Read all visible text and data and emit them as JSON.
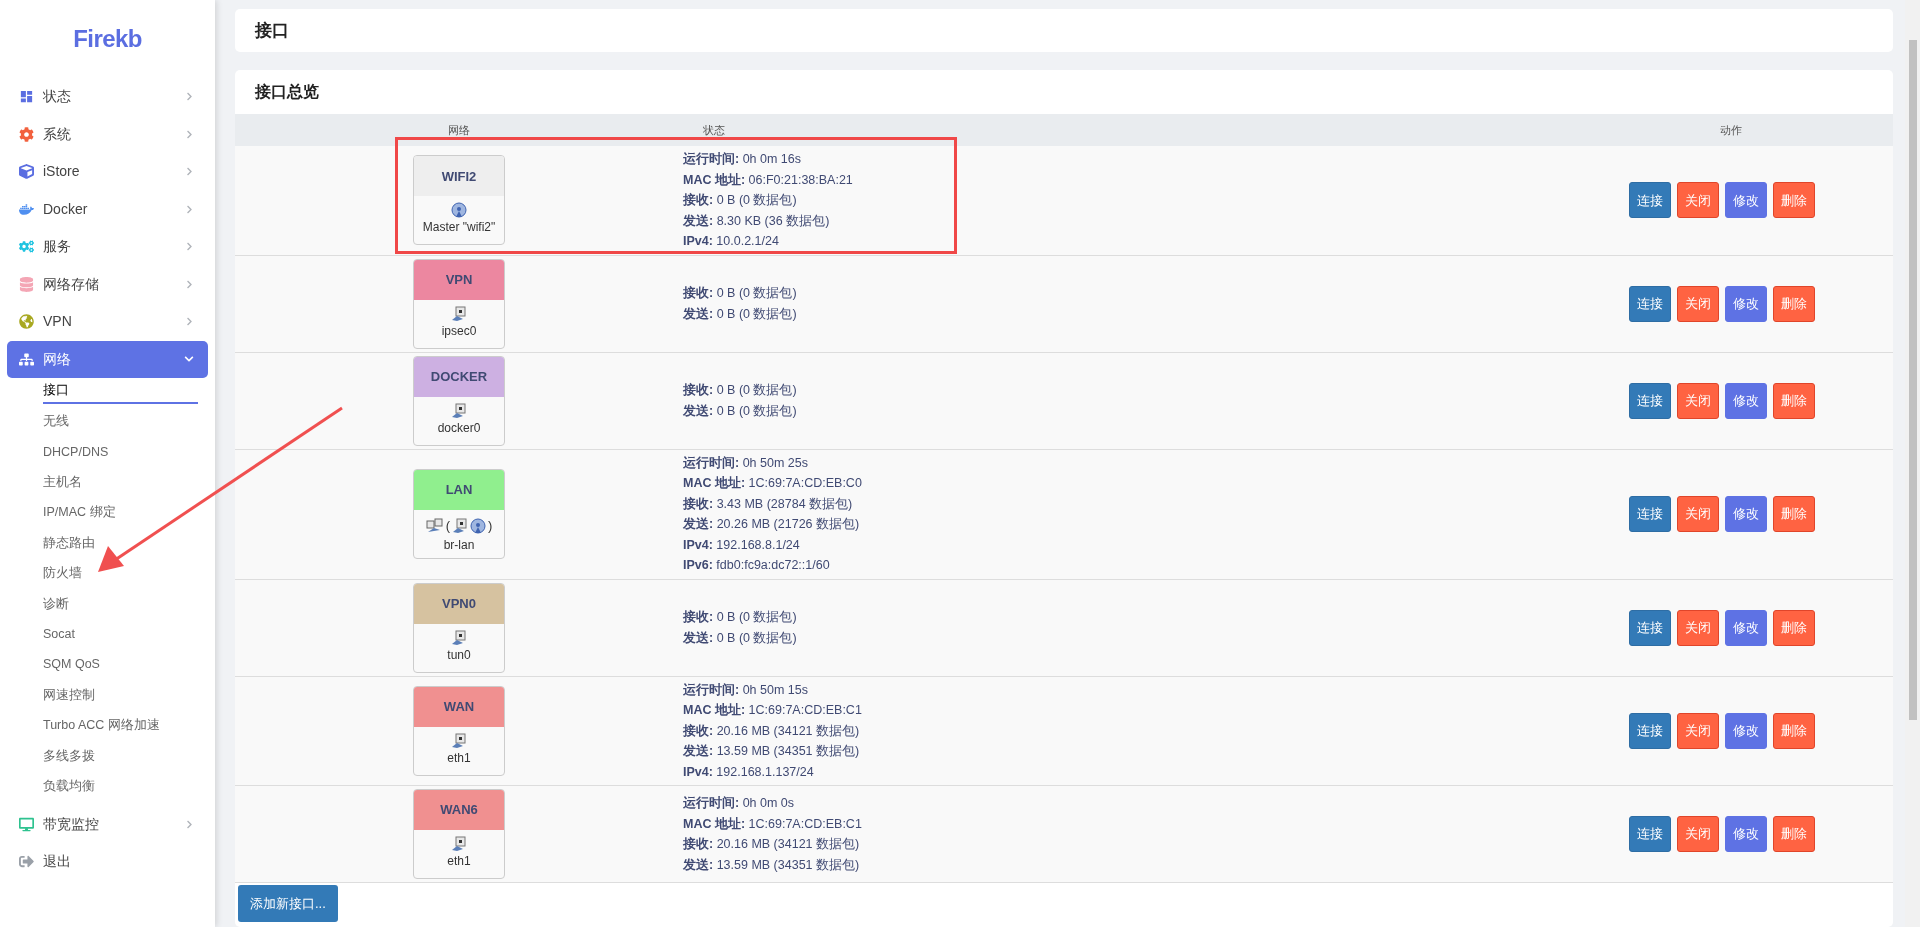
{
  "sidebar": {
    "logo": "Firekb",
    "items": [
      {
        "label": "状态",
        "expanded": false,
        "selected": false
      },
      {
        "label": "系统",
        "expanded": false,
        "selected": false
      },
      {
        "label": "iStore",
        "expanded": false,
        "selected": false
      },
      {
        "label": "Docker",
        "expanded": false,
        "selected": false
      },
      {
        "label": "服务",
        "expanded": false,
        "selected": false
      },
      {
        "label": "网络存储",
        "expanded": false,
        "selected": false
      },
      {
        "label": "VPN",
        "expanded": false,
        "selected": false
      },
      {
        "label": "网络",
        "expanded": true,
        "selected": true,
        "children": [
          {
            "label": "接口",
            "selected": true
          },
          {
            "label": "无线",
            "selected": false
          },
          {
            "label": "DHCP/DNS",
            "selected": false
          },
          {
            "label": "主机名",
            "selected": false
          },
          {
            "label": "IP/MAC 绑定",
            "selected": false
          },
          {
            "label": "静态路由",
            "selected": false
          },
          {
            "label": "防火墙",
            "selected": false
          },
          {
            "label": "诊断",
            "selected": false
          },
          {
            "label": "Socat",
            "selected": false
          },
          {
            "label": "SQM QoS",
            "selected": false
          },
          {
            "label": "网速控制",
            "selected": false
          },
          {
            "label": "Turbo ACC 网络加速",
            "selected": false
          },
          {
            "label": "多线多拨",
            "selected": false
          },
          {
            "label": "负载均衡",
            "selected": false
          }
        ]
      },
      {
        "label": "带宽监控",
        "expanded": false,
        "selected": false
      },
      {
        "label": "退出",
        "selected": false
      }
    ]
  },
  "page_title": "接口",
  "overview": {
    "title": "接口总览",
    "columns": [
      "网络",
      "状态",
      "动作"
    ],
    "rows": [
      {
        "name": "WIFI2",
        "color": "#eeeeee",
        "device": {
          "kind": "wifi",
          "label": "Master \"wifi2\""
        },
        "status": [
          "**运行时间:** 0h 0m 16s",
          "**MAC 地址:** 06:F0:21:38:BA:21",
          "**接收:** 0 B (0 数据包)",
          "**发送:** 8.30 KB (36 数据包)",
          "**IPv4:** 10.0.2.1/24"
        ],
        "highlighted": true,
        "actions": [
          {
            "kind": "connect",
            "label": "连接"
          },
          {
            "kind": "stop",
            "label": "关闭"
          },
          {
            "kind": "edit",
            "label": "修改"
          },
          {
            "kind": "delete",
            "label": "删除"
          }
        ]
      },
      {
        "name": "VPN",
        "color": "#ec87a0",
        "device": {
          "kind": "ethernet",
          "label": "ipsec0"
        },
        "status": [
          "**接收:** 0 B (0 数据包)",
          "**发送:** 0 B (0 数据包)"
        ],
        "highlighted": false,
        "actions": [
          {
            "kind": "connect",
            "label": "连接"
          },
          {
            "kind": "stop",
            "label": "关闭"
          },
          {
            "kind": "edit",
            "label": "修改"
          },
          {
            "kind": "delete",
            "label": "删除"
          }
        ]
      },
      {
        "name": "DOCKER",
        "color": "#cdb0e2",
        "device": {
          "kind": "ethernet",
          "label": "docker0"
        },
        "status": [
          "**接收:** 0 B (0 数据包)",
          "**发送:** 0 B (0 数据包)"
        ],
        "highlighted": false,
        "actions": [
          {
            "kind": "connect",
            "label": "连接"
          },
          {
            "kind": "stop",
            "label": "关闭"
          },
          {
            "kind": "edit",
            "label": "修改"
          },
          {
            "kind": "delete",
            "label": "删除"
          }
        ]
      },
      {
        "name": "LAN",
        "color": "#90ef8e",
        "device": {
          "kind": "bridge",
          "open": "(",
          "close": ")",
          "label": "br-lan"
        },
        "status": [
          "**运行时间:** 0h 50m 25s",
          "**MAC 地址:** 1C:69:7A:CD:EB:C0",
          "**接收:** 3.43 MB (28784 数据包)",
          "**发送:** 20.26 MB (21726 数据包)",
          "**IPv4:** 192.168.8.1/24",
          "**IPv6:** fdb0:fc9a:dc72::1/60"
        ],
        "highlighted": false,
        "actions": [
          {
            "kind": "connect",
            "label": "连接"
          },
          {
            "kind": "stop",
            "label": "关闭"
          },
          {
            "kind": "edit",
            "label": "修改"
          },
          {
            "kind": "delete",
            "label": "删除"
          }
        ]
      },
      {
        "name": "VPN0",
        "color": "#d6c2a0",
        "device": {
          "kind": "ethernet",
          "label": "tun0"
        },
        "status": [
          "**接收:** 0 B (0 数据包)",
          "**发送:** 0 B (0 数据包)"
        ],
        "highlighted": false,
        "actions": [
          {
            "kind": "connect",
            "label": "连接"
          },
          {
            "kind": "stop",
            "label": "关闭"
          },
          {
            "kind": "edit",
            "label": "修改"
          },
          {
            "kind": "delete",
            "label": "删除"
          }
        ]
      },
      {
        "name": "WAN",
        "color": "#f09090",
        "device": {
          "kind": "ethernet",
          "label": "eth1"
        },
        "status": [
          "**运行时间:** 0h 50m 15s",
          "**MAC 地址:** 1C:69:7A:CD:EB:C1",
          "**接收:** 20.16 MB (34121 数据包)",
          "**发送:** 13.59 MB (34351 数据包)",
          "**IPv4:** 192.168.1.137/24"
        ],
        "highlighted": false,
        "actions": [
          {
            "kind": "connect",
            "label": "连接"
          },
          {
            "kind": "stop",
            "label": "关闭"
          },
          {
            "kind": "edit",
            "label": "修改"
          },
          {
            "kind": "delete",
            "label": "删除"
          }
        ]
      },
      {
        "name": "WAN6",
        "color": "#f09090",
        "device": {
          "kind": "ethernet",
          "label": "eth1"
        },
        "status": [
          "**运行时间:** 0h 0m 0s",
          "**MAC 地址:** 1C:69:7A:CD:EB:C1",
          "**接收:** 20.16 MB (34121 数据包)",
          "**发送:** 13.59 MB (34351 数据包)"
        ],
        "highlighted": false,
        "actions": [
          {
            "kind": "connect",
            "label": "连接"
          },
          {
            "kind": "stop",
            "label": "关闭"
          },
          {
            "kind": "edit",
            "label": "修改"
          },
          {
            "kind": "delete",
            "label": "删除"
          }
        ]
      }
    ],
    "add_button": "添加新接口..."
  }
}
